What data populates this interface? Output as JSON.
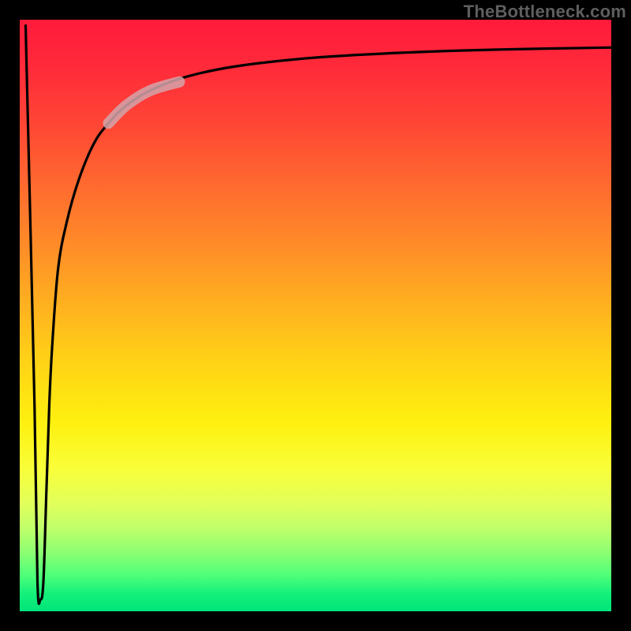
{
  "watermark": "TheBottleneck.com",
  "chart_data": {
    "type": "line",
    "title": "",
    "xlabel": "",
    "ylabel": "",
    "xlim": [
      0,
      100
    ],
    "ylim": [
      0,
      100
    ],
    "grid": false,
    "legend": false,
    "annotations": [],
    "series": [
      {
        "name": "bottleneck-curve",
        "color": "#000000",
        "x": [
          1.0,
          2.5,
          3.0,
          3.5,
          4.0,
          4.5,
          5.0,
          5.5,
          6.5,
          8.0,
          10.0,
          12.5,
          15.0,
          18.0,
          22.0,
          27.0,
          33.0,
          40.0,
          50.0,
          62.0,
          75.0,
          88.0,
          100.0
        ],
        "y": [
          99.0,
          35.0,
          5.0,
          2.0,
          5.0,
          20.0,
          35.0,
          45.0,
          58.0,
          66.0,
          73.0,
          79.0,
          82.5,
          85.5,
          88.0,
          90.0,
          91.5,
          92.6,
          93.6,
          94.3,
          94.8,
          95.1,
          95.3
        ]
      },
      {
        "name": "highlight-segment",
        "color": "#d0a0a0",
        "x": [
          15.0,
          18.0,
          22.0,
          27.0
        ],
        "y": [
          82.5,
          85.5,
          88.0,
          89.5
        ]
      }
    ]
  }
}
